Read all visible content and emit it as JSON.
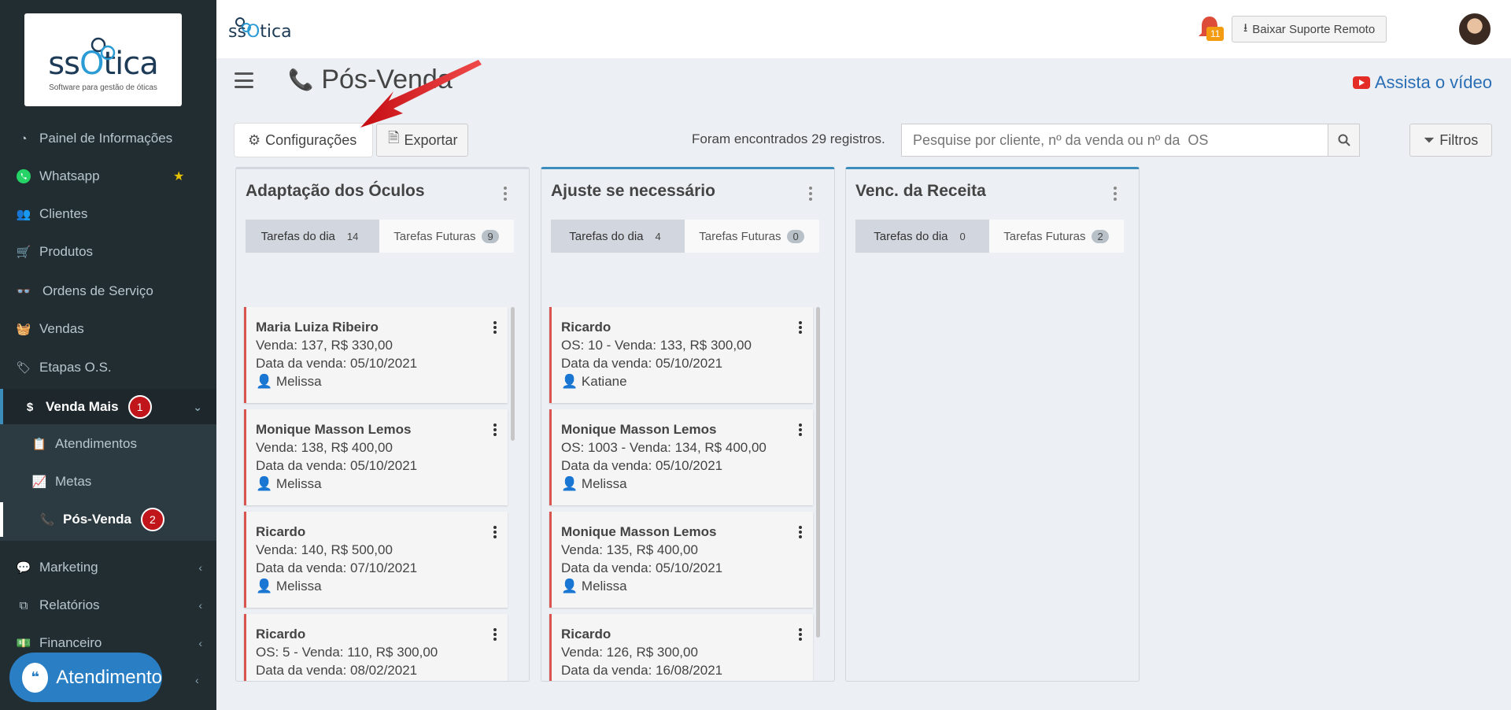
{
  "sidebar": {
    "logo_text": "ssOtica",
    "logo_sub": "Software para gestão de óticas",
    "items": [
      {
        "label": "Painel de Informações"
      },
      {
        "label": "Whatsapp"
      },
      {
        "label": "Clientes"
      },
      {
        "label": "Produtos"
      },
      {
        "label": "Ordens de Serviço"
      },
      {
        "label": "Vendas"
      },
      {
        "label": "Etapas O.S."
      },
      {
        "label": "Venda Mais",
        "badge": "1"
      },
      {
        "label": "Atendimentos"
      },
      {
        "label": "Metas"
      },
      {
        "label": "Pós-Venda",
        "badge": "2"
      },
      {
        "label": "Marketing"
      },
      {
        "label": "Relatórios"
      },
      {
        "label": "Financeiro"
      }
    ],
    "atendimento_label": "Atendimento"
  },
  "header": {
    "logo_text": "ssOtica",
    "suporte_label": "Baixar Suporte Remoto",
    "notif_count": "11"
  },
  "page": {
    "title": "Pós-Venda",
    "video_link": "Assista o vídeo"
  },
  "toolbar": {
    "config_label": "Configurações",
    "export_label": "Exportar",
    "records_text": "Foram encontrados 29 registros.",
    "search_placeholder": "Pesquise por cliente, nº da venda ou nº da  OS",
    "filters_label": "Filtros"
  },
  "columns": [
    {
      "title": "Adaptação dos Óculos",
      "tab_today": "Tarefas do dia",
      "tab_today_count": "14",
      "tab_future": "Tarefas Futuras",
      "tab_future_count": "9",
      "cards": [
        {
          "name": "Maria Luiza Ribeiro",
          "line1": "Venda: 137, R$ 330,00",
          "line2": "Data da venda: 05/10/2021",
          "user": "Melissa"
        },
        {
          "name": "Monique Masson Lemos",
          "line1": "Venda: 138, R$ 400,00",
          "line2": "Data da venda: 05/10/2021",
          "user": "Melissa"
        },
        {
          "name": "Ricardo",
          "line1": "Venda: 140, R$ 500,00",
          "line2": "Data da venda: 07/10/2021",
          "user": "Melissa"
        },
        {
          "name": "Ricardo",
          "line1": "OS: 5 - Venda: 110, R$ 300,00",
          "line2": "Data da venda: 08/02/2021",
          "user": ""
        }
      ]
    },
    {
      "title": "Ajuste se necessário",
      "tab_today": "Tarefas do dia",
      "tab_today_count": "4",
      "tab_future": "Tarefas Futuras",
      "tab_future_count": "0",
      "cards": [
        {
          "name": "Ricardo",
          "line1": "OS: 10 - Venda: 133, R$ 300,00",
          "line2": "Data da venda: 05/10/2021",
          "user": "Katiane"
        },
        {
          "name": "Monique Masson Lemos",
          "line1": "OS: 1003 - Venda: 134, R$ 400,00",
          "line2": "Data da venda: 05/10/2021",
          "user": "Melissa"
        },
        {
          "name": "Monique Masson Lemos",
          "line1": "Venda: 135, R$ 400,00",
          "line2": "Data da venda: 05/10/2021",
          "user": "Melissa"
        },
        {
          "name": "Ricardo",
          "line1": "Venda: 126, R$ 300,00",
          "line2": "Data da venda: 16/08/2021",
          "user": ""
        }
      ]
    },
    {
      "title": "Venc. da Receita",
      "tab_today": "Tarefas do dia",
      "tab_today_count": "0",
      "tab_future": "Tarefas Futuras",
      "tab_future_count": "2",
      "cards": []
    }
  ],
  "colors": {
    "accent": "#3c8dbc",
    "sidebar": "#222d32",
    "card_border": "#d9534f",
    "badge": "#c0151b"
  }
}
